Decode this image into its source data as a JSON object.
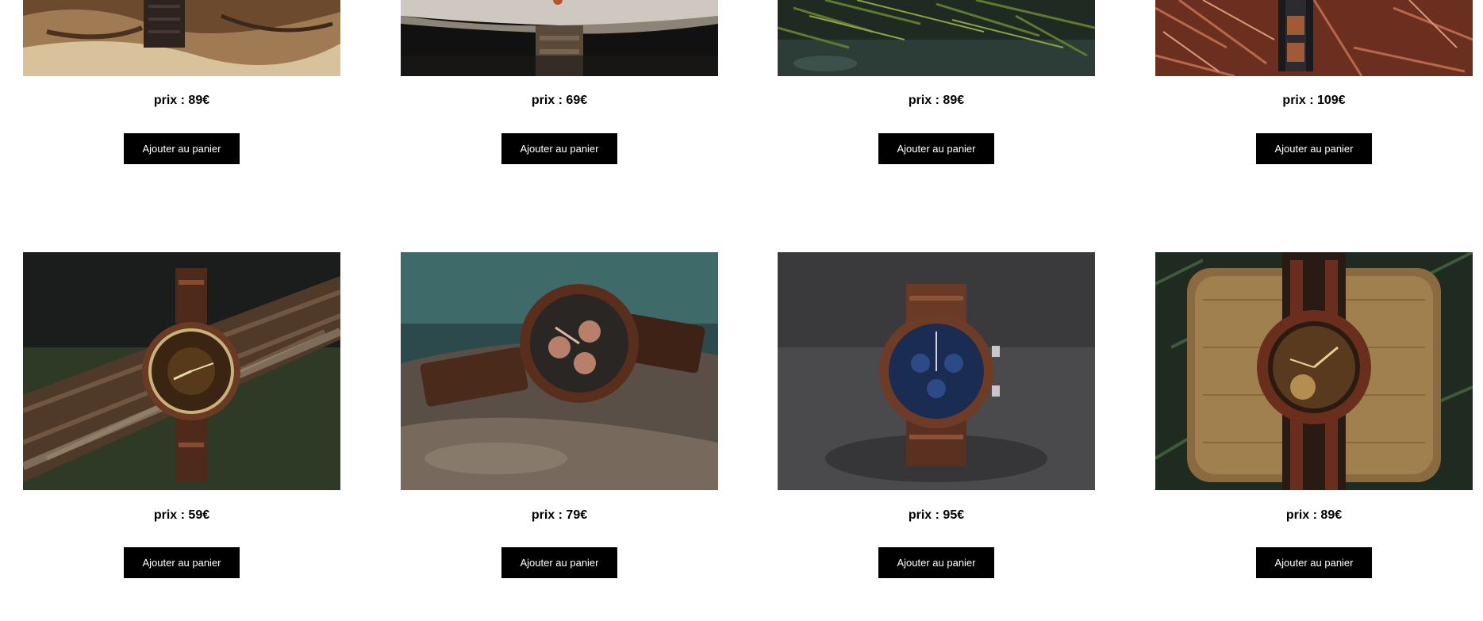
{
  "products": [
    {
      "price": "prix : 89€",
      "button": "Ajouter au panier",
      "image": "wooden-watch-on-driftwood"
    },
    {
      "price": "prix : 69€",
      "button": "Ajouter au panier",
      "image": "wooden-watch-on-stone"
    },
    {
      "price": "prix : 89€",
      "button": "Ajouter au panier",
      "image": "wooden-watch-in-pine"
    },
    {
      "price": "prix : 109€",
      "button": "Ajouter au panier",
      "image": "wooden-watch-on-needles"
    },
    {
      "price": "prix : 59€",
      "button": "Ajouter au panier",
      "image": "wooden-watch-on-branch"
    },
    {
      "price": "prix : 79€",
      "button": "Ajouter au panier",
      "image": "wooden-chronograph-on-rock"
    },
    {
      "price": "prix : 95€",
      "button": "Ajouter au panier",
      "image": "blue-dial-chronograph-on-asphalt"
    },
    {
      "price": "prix : 89€",
      "button": "Ajouter au panier",
      "image": "wooden-watch-on-burlap-pillow"
    }
  ]
}
